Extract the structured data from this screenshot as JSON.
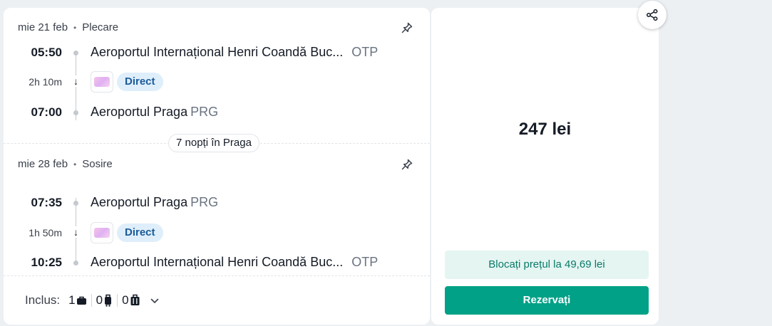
{
  "outbound": {
    "date": "mie 21 feb",
    "type": "Plecare",
    "dep_time": "05:50",
    "dep_airport": "Aeroportul Internațional Henri Coandă Buc...",
    "dep_code": "OTP",
    "duration": "2h 10m",
    "stop_label": "Direct",
    "arr_time": "07:00",
    "arr_airport": "Aeroportul Praga",
    "arr_code": "PRG",
    "pin_icon": "pin-icon"
  },
  "stay_label": "7 nopți în Praga",
  "return": {
    "date": "mie 28 feb",
    "type": "Sosire",
    "dep_time": "07:35",
    "dep_airport": "Aeroportul Praga",
    "dep_code": "PRG",
    "duration": "1h 50m",
    "stop_label": "Direct",
    "arr_time": "10:25",
    "arr_airport": "Aeroportul Internațional Henri Coandă Buc...",
    "arr_code": "OTP",
    "pin_icon": "pin-icon"
  },
  "included": {
    "label": "Inclus:",
    "personal_item": "1",
    "carry_on": "0",
    "checked": "0"
  },
  "pricing": {
    "price": "247 lei",
    "lock_label": "Blocați prețul la 49,69 lei",
    "book_label": "Rezervați"
  },
  "colors": {
    "accent": "#00a187",
    "direct_badge_bg": "#dfeefb",
    "direct_badge_text": "#1a5b99"
  }
}
